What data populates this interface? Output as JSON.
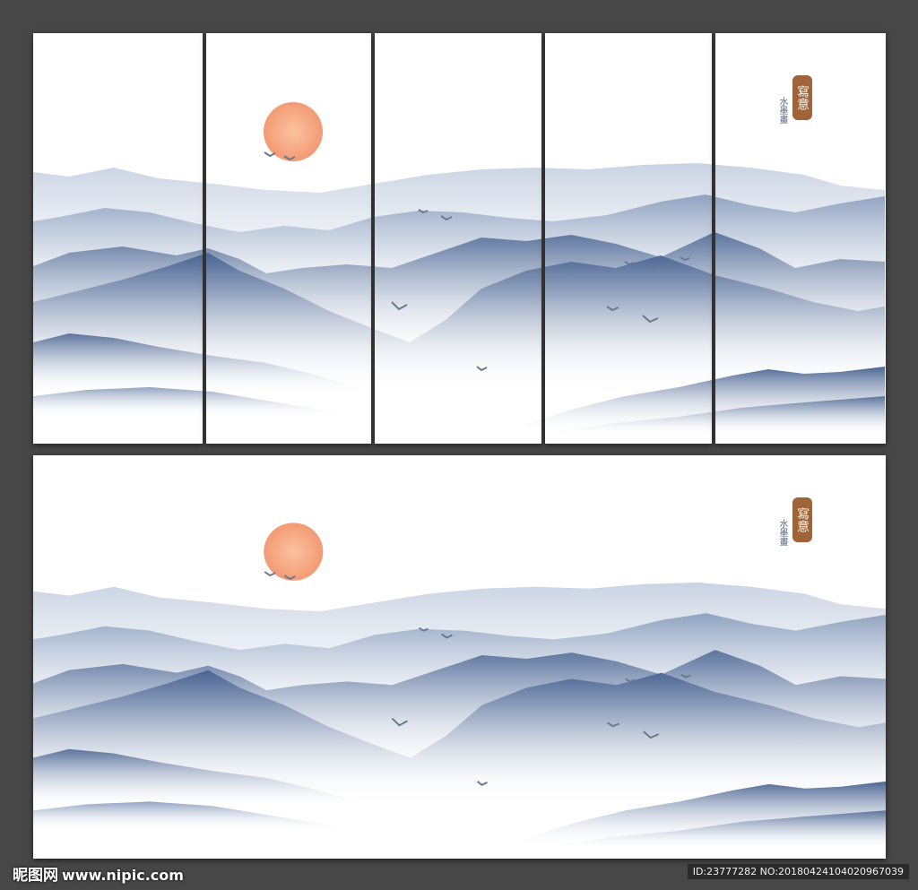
{
  "image": {
    "background_color": "#474747",
    "panel_color": "#ffffff",
    "mountain_colors": [
      "#dde4ee",
      "#b7c5d9",
      "#8ea3c2",
      "#6b84a9",
      "#4a6593"
    ],
    "sun_color": "#f4a27f",
    "seal_color": "#a0643a"
  },
  "seal": {
    "main_text": "寫意",
    "sub_text": "水墨畫"
  },
  "watermark": {
    "logo_text": "昵图网",
    "site_text": "www.nipic.com",
    "id_text": "ID:23777282 NO:20180424104020967039"
  }
}
